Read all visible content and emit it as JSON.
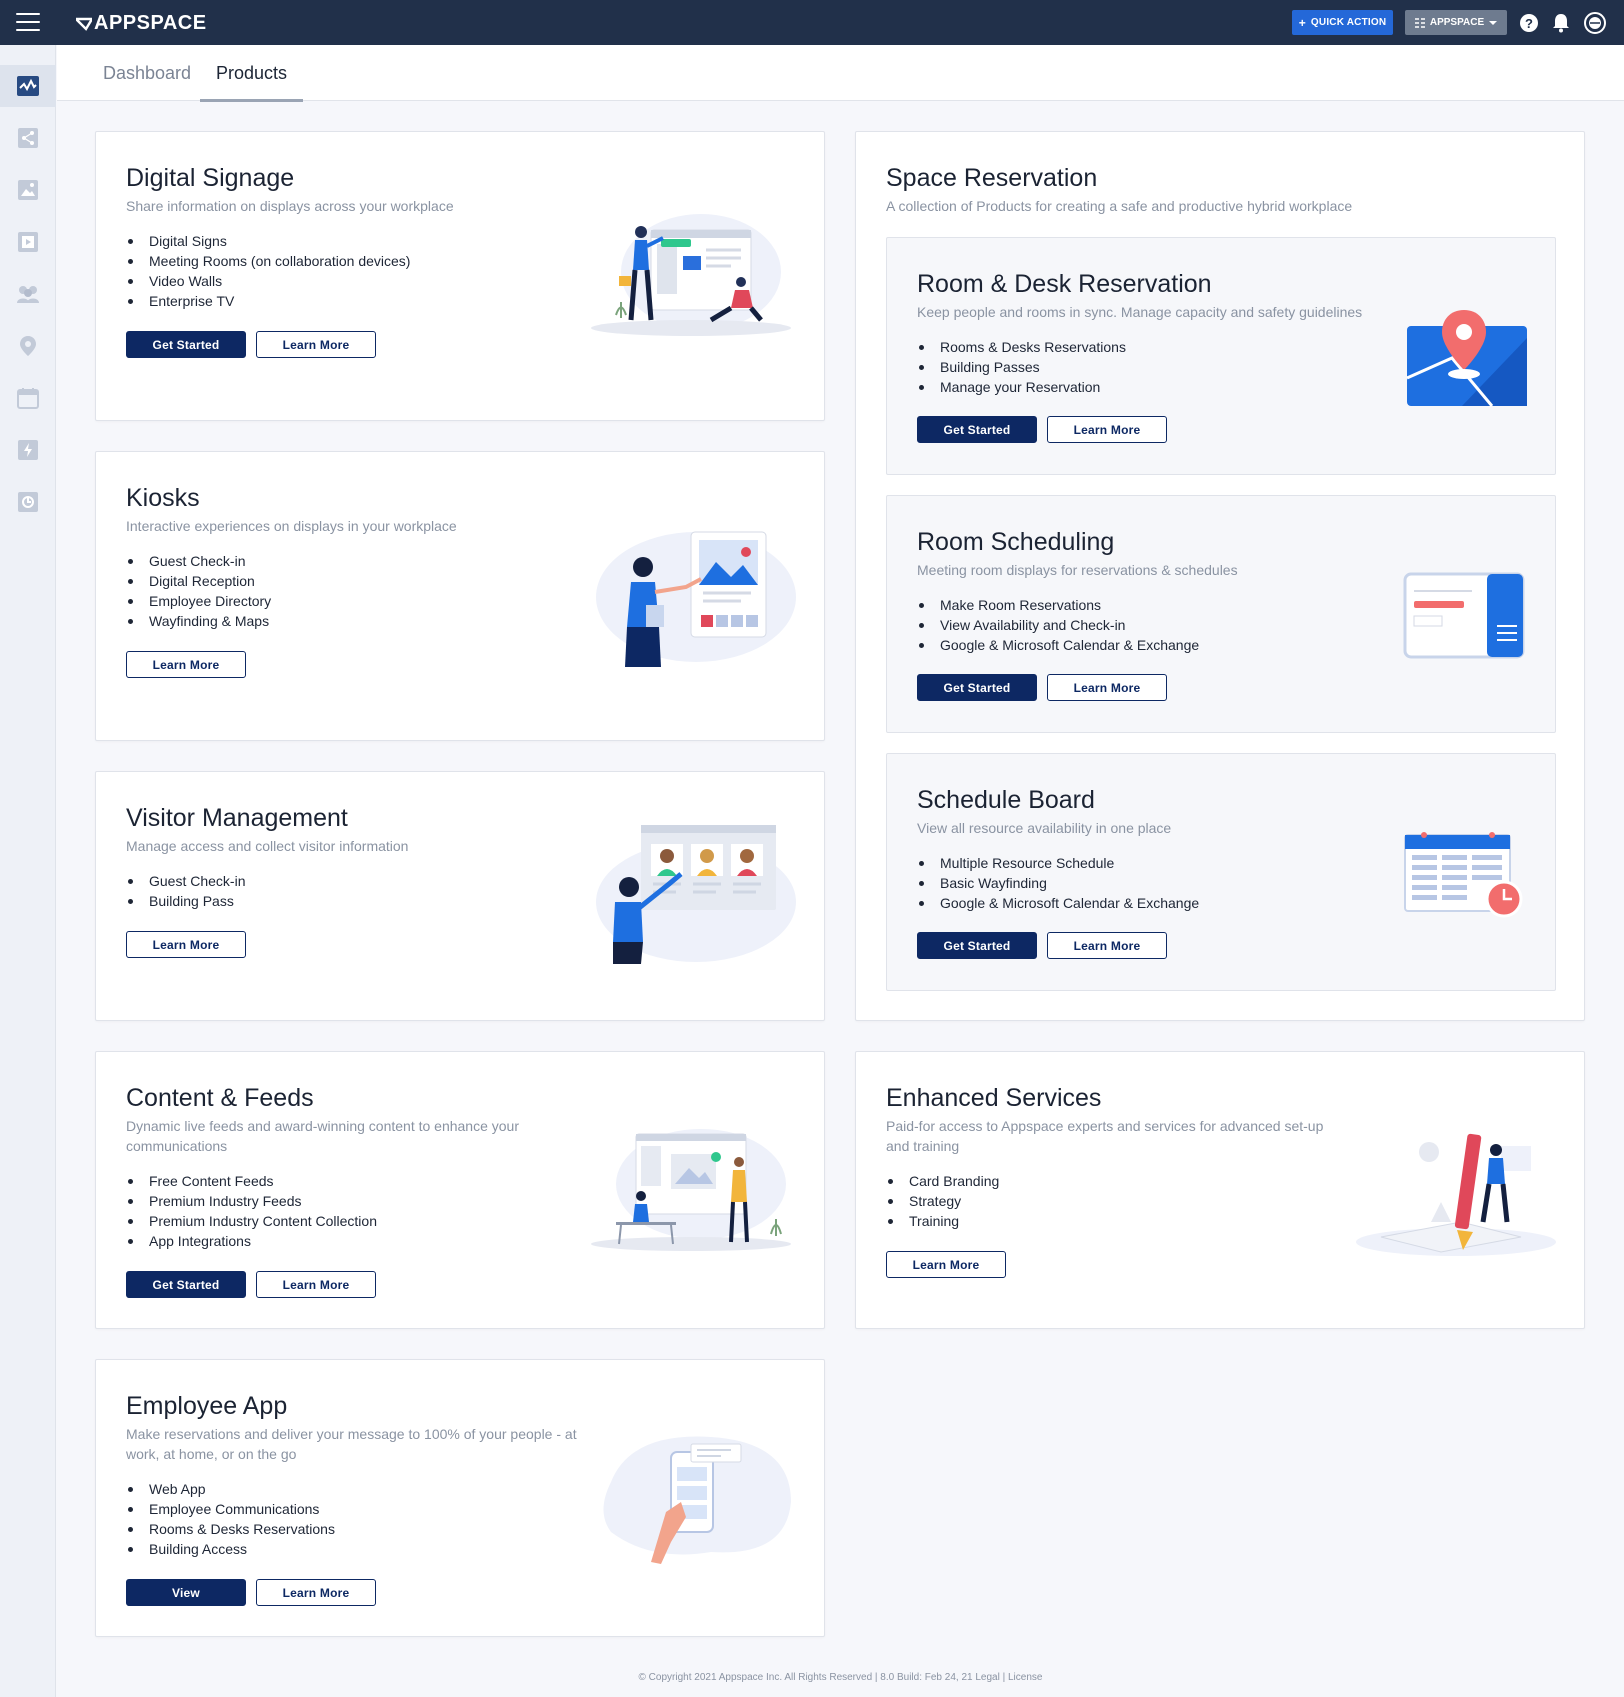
{
  "topbar": {
    "brand": "APPSPACE",
    "quick_action_label": "QUICK ACTION",
    "account_label": "APPSPACE"
  },
  "tabs": [
    {
      "label": "Dashboard"
    },
    {
      "label": "Products"
    }
  ],
  "products": {
    "digital_signage": {
      "title": "Digital Signage",
      "desc": "Share information on displays across your workplace",
      "items": [
        "Digital Signs",
        "Meeting Rooms (on collaboration devices)",
        "Video Walls",
        "Enterprise TV"
      ],
      "primary": "Get Started",
      "secondary": "Learn More"
    },
    "kiosks": {
      "title": "Kiosks",
      "desc": "Interactive experiences on displays in your workplace",
      "items": [
        "Guest Check-in",
        "Digital Reception",
        "Employee Directory",
        "Wayfinding & Maps"
      ],
      "secondary": "Learn More"
    },
    "visitor": {
      "title": "Visitor Management",
      "desc": "Manage access and collect visitor information",
      "items": [
        "Guest Check-in",
        "Building Pass"
      ],
      "secondary": "Learn More"
    },
    "content": {
      "title": "Content & Feeds",
      "desc_line1": "Dynamic live feeds and award-winning content to enhance your",
      "desc_line2": "communications",
      "items": [
        "Free Content Feeds",
        "Premium Industry Feeds",
        "Premium Industry Content Collection",
        "App Integrations"
      ],
      "primary": "Get Started",
      "secondary": "Learn More"
    },
    "employee_app": {
      "title": "Employee App",
      "desc_line1": "Make reservations and deliver your message to 100% of your people - at",
      "desc_line2": "work, at home, or on the go",
      "items": [
        "Web App",
        "Employee Communications",
        "Rooms & Desks Reservations",
        "Building Access"
      ],
      "primary": "View",
      "secondary": "Learn More"
    },
    "space": {
      "title": "Space Reservation",
      "desc": "A collection of Products for creating a safe and productive hybrid workplace",
      "room_desk": {
        "title": "Room & Desk Reservation",
        "desc": "Keep people and rooms in sync. Manage capacity and safety guidelines",
        "items": [
          "Rooms & Desks Reservations",
          "Building Passes",
          "Manage your Reservation"
        ],
        "primary": "Get Started",
        "secondary": "Learn More"
      },
      "room_scheduling": {
        "title": "Room Scheduling",
        "desc": "Meeting room displays for reservations & schedules",
        "items": [
          "Make Room Reservations",
          "View Availability and Check-in",
          "Google & Microsoft Calendar & Exchange"
        ],
        "primary": "Get Started",
        "secondary": "Learn More"
      },
      "schedule_board": {
        "title": "Schedule Board",
        "desc": "View all resource availability in one place",
        "items": [
          "Multiple Resource Schedule",
          "Basic Wayfinding",
          "Google & Microsoft Calendar & Exchange"
        ],
        "primary": "Get Started",
        "secondary": "Learn More"
      }
    },
    "enhanced": {
      "title": "Enhanced Services",
      "desc_line1": "Paid-for access to Appspace experts and services for advanced set-up",
      "desc_line2": "and training",
      "items": [
        "Card Branding",
        "Strategy",
        "Training"
      ],
      "secondary": "Learn More"
    }
  },
  "footer": {
    "text": "© Copyright 2021 Appspace Inc. All Rights Reserved  | 8.0   Build: Feb 24, 21   Legal | License"
  },
  "colors": {
    "topbar": "#21304a",
    "primary_button": "#0d2863",
    "quick_action": "#2468d8",
    "illustration_blue": "#1e6fe0"
  },
  "icons": {
    "sidebar": [
      "dashboard-icon",
      "share-icon",
      "image-icon",
      "media-icon",
      "users-icon",
      "location-icon",
      "calendar-icon",
      "flash-icon",
      "settings-icon"
    ],
    "topbar": [
      "help-icon",
      "bell-icon",
      "account-icon"
    ]
  }
}
